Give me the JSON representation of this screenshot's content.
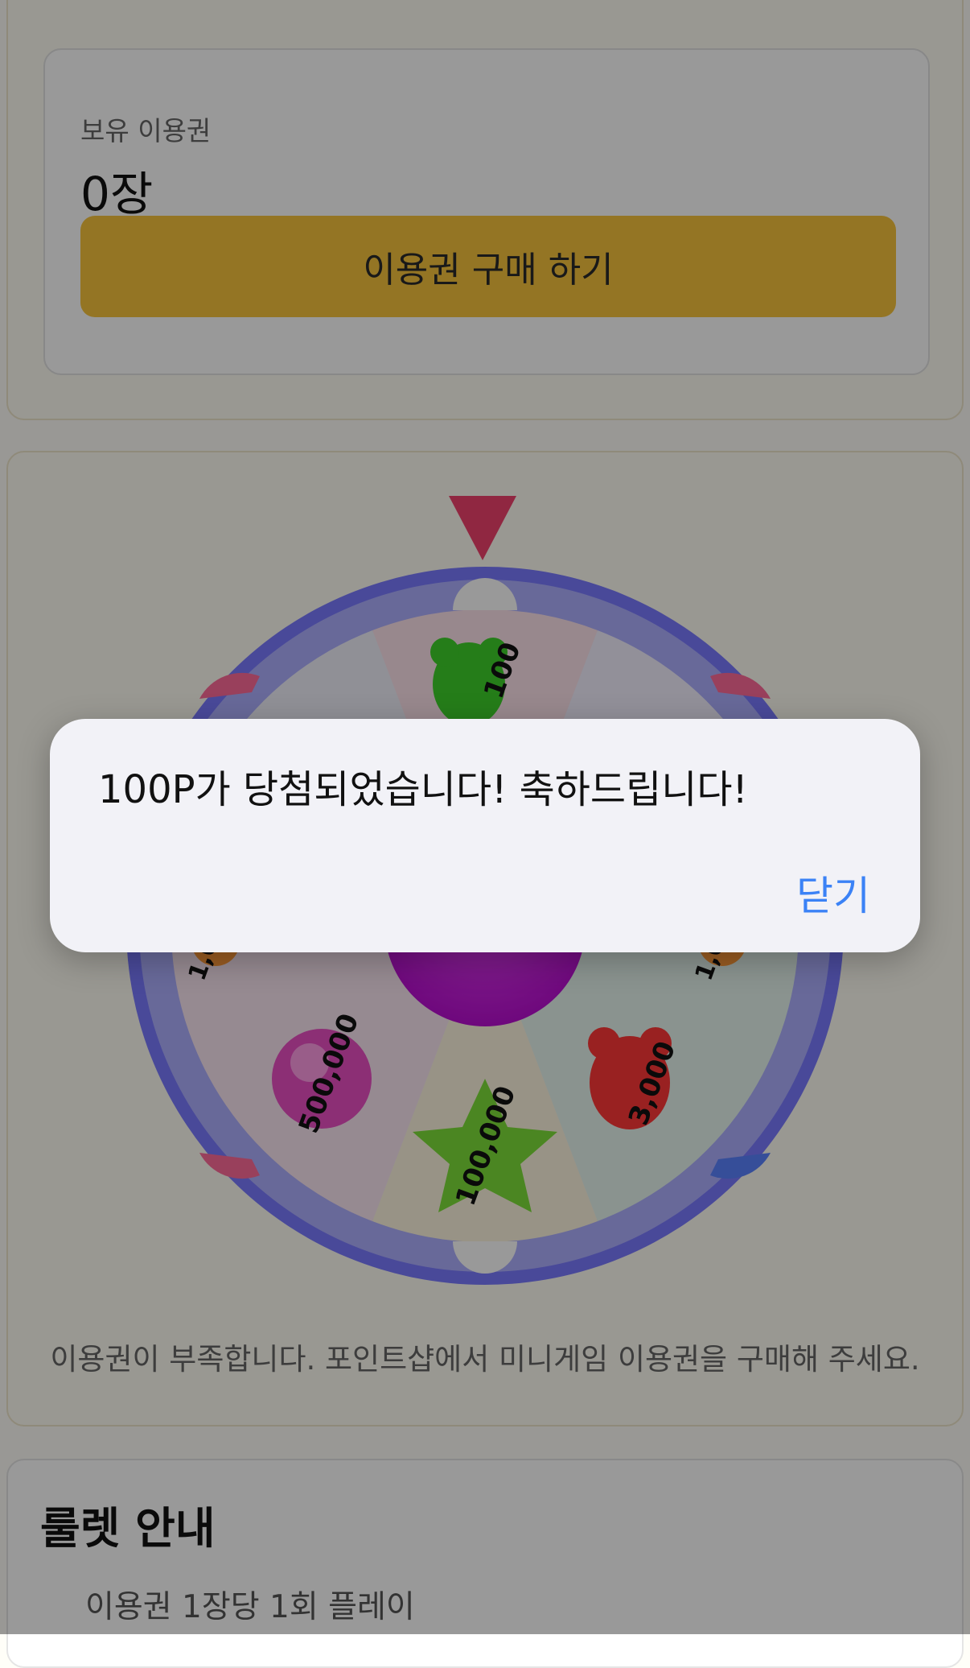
{
  "ticket": {
    "label": "보유 이용권",
    "count": "0장",
    "buy_button": "이용권 구매 하기"
  },
  "roulette": {
    "prizes": [
      "100",
      "1,000",
      "500,000",
      "100,000",
      "3,000",
      "1,000"
    ],
    "notice": "이용권이 부족합니다. 포인트샵에서 미니게임 이용권을 구매해 주세요."
  },
  "guide": {
    "title": "룰렛 안내",
    "items": [
      "이용권 1장당 1회 플레이"
    ]
  },
  "alert": {
    "message": "100P가 당첨되었습니다! 축하드립니다!",
    "close": "닫기"
  },
  "colors": {
    "accent_yellow": "#f7c33d",
    "pointer_pink": "#f0426d",
    "wheel_rim": "#6c6cff",
    "alert_link": "#3b82f6"
  }
}
